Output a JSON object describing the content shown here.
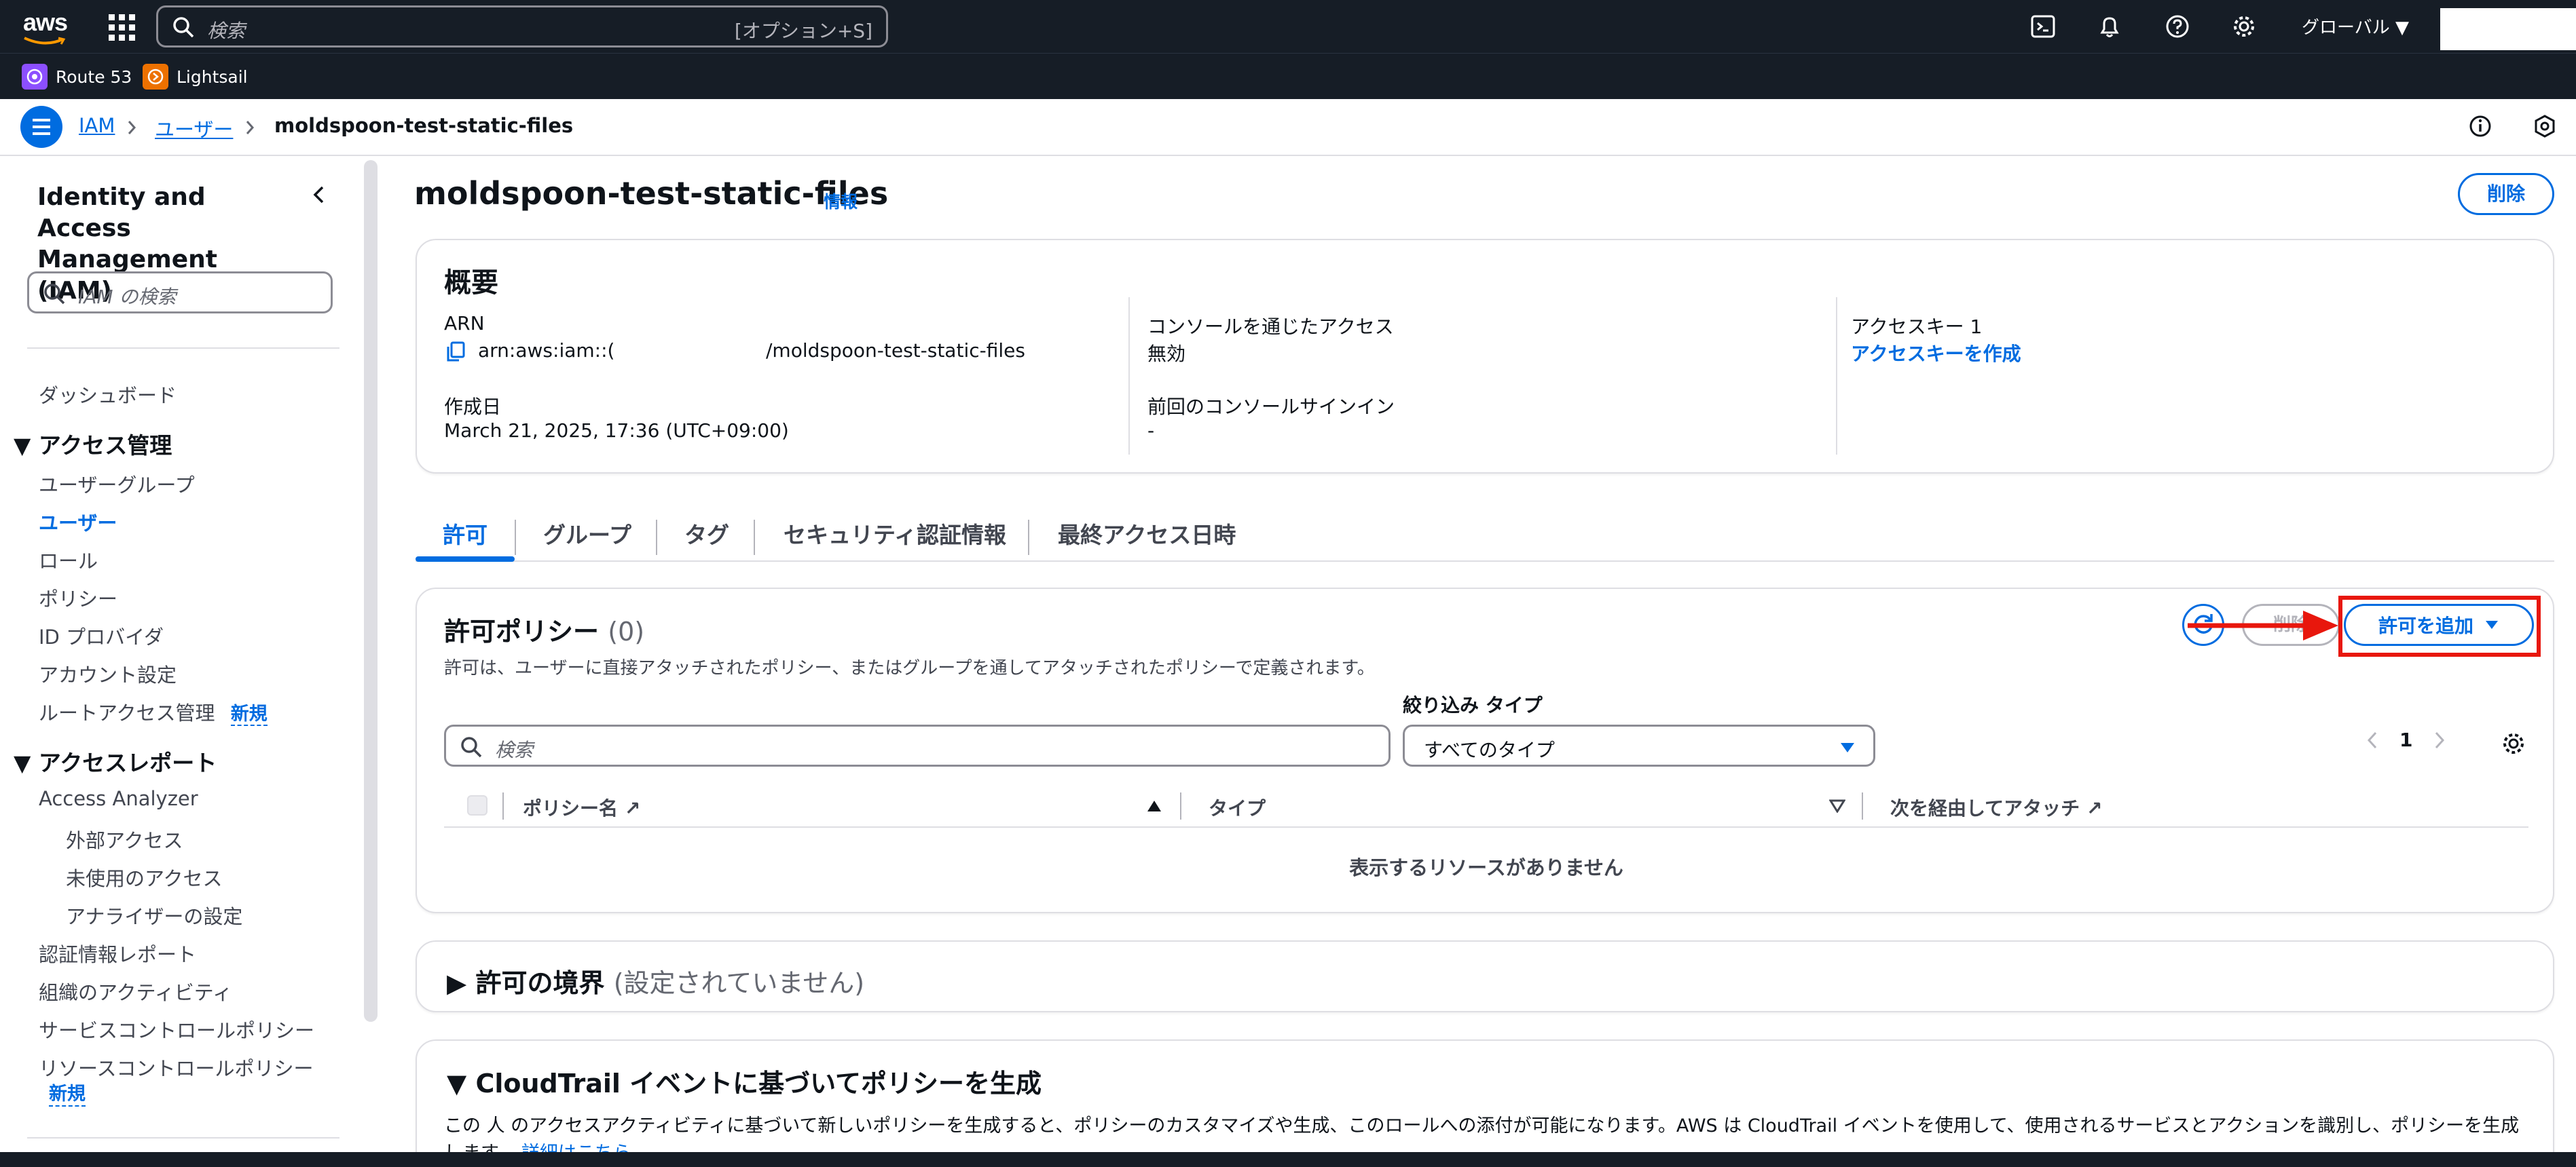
{
  "topnav": {
    "logo": "aws",
    "search_placeholder": "検索",
    "search_shortcut": "[オプション+S]",
    "region": "グローバル ▼"
  },
  "favorites": [
    {
      "label": "Route 53",
      "color": "#8c4fff"
    },
    {
      "label": "Lightsail",
      "color": "#ed7100"
    }
  ],
  "breadcrumb": {
    "items": [
      "IAM",
      "ユーザー"
    ],
    "current": "moldspoon-test-static-files"
  },
  "sidebar": {
    "title": "Identity and Access Management (IAM)",
    "search_placeholder": "IAM の検索",
    "dashboard": "ダッシュボード",
    "access_mgmt_heading": "アクセス管理",
    "access_mgmt_items": [
      "ユーザーグループ",
      "ユーザー",
      "ロール",
      "ポリシー",
      "ID プロバイダ",
      "アカウント設定",
      "ルートアクセス管理"
    ],
    "new_badge": "新規",
    "reports_heading": "アクセスレポート",
    "access_analyzer": "Access Analyzer",
    "analyzer_items": [
      "外部アクセス",
      "未使用のアクセス",
      "アナライザーの設定"
    ],
    "report_items": [
      "認証情報レポート",
      "組織のアクティビティ",
      "サービスコントロールポリシー",
      "リソースコントロールポリシー"
    ]
  },
  "page": {
    "title": "moldspoon-test-static-files",
    "info": "情報",
    "delete_label": "削除"
  },
  "summary": {
    "title": "概要",
    "arn_label": "ARN",
    "arn_prefix": "arn:aws:iam::(",
    "arn_suffix": "/moldspoon-test-static-files",
    "created_label": "作成日",
    "created_value": "March 21, 2025, 17:36 (UTC+09:00)",
    "console_access_label": "コンソールを通じたアクセス",
    "console_access_value": "無効",
    "last_signin_label": "前回のコンソールサインイン",
    "last_signin_value": "-",
    "access_key_label": "アクセスキー 1",
    "access_key_link": "アクセスキーを作成"
  },
  "tabs": [
    "許可",
    "グループ",
    "タグ",
    "セキュリティ認証情報",
    "最終アクセス日時"
  ],
  "policies": {
    "title": "許可ポリシー",
    "count": "(0)",
    "description": "許可は、ユーザーに直接アタッチされたポリシー、またはグループを通してアタッチされたポリシーで定義されます。",
    "remove_label": "削除",
    "add_label": "許可を追加",
    "search_placeholder": "検索",
    "filter_type_label": "絞り込み タイプ",
    "filter_type_value": "すべてのタイプ",
    "page_number": "1",
    "columns": [
      "ポリシー名",
      "タイプ",
      "次を経由してアタッチ"
    ],
    "empty": "表示するリソースがありません"
  },
  "boundary": {
    "title": "許可の境界",
    "subtitle": "(設定されていません)"
  },
  "cloudtrail": {
    "title": "CloudTrail イベントに基づいてポリシーを生成",
    "description": "この 人 のアクセスアクティビティに基づいて新しいポリシーを生成すると、ポリシーのカスタマイズや生成、このロールへの添付が可能になります。AWS は CloudTrail イベントを使用して、使用されるサービスとアクションを識別し、ポリシーを生成します。",
    "link": "詳細はこちら"
  },
  "colors": {
    "nav_bg": "#161d26",
    "accent": "#006ce0",
    "highlight": "#e8170d"
  }
}
